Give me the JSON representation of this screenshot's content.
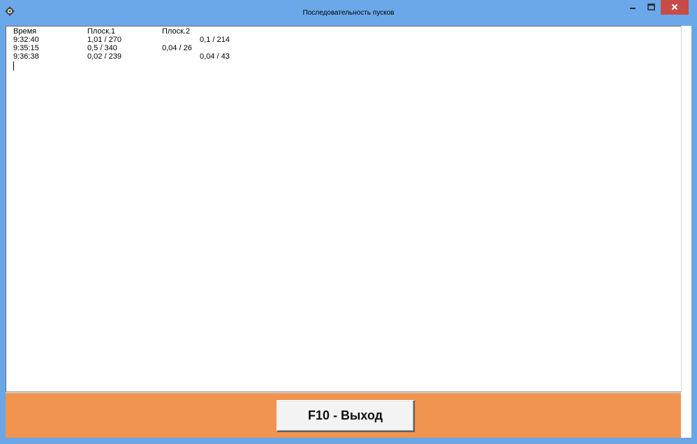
{
  "window": {
    "title": "Последовательность пусков",
    "icon": "gear-icon",
    "controls": [
      "minimize-icon",
      "maximize-icon",
      "close-icon"
    ]
  },
  "table": {
    "headers": [
      "Время",
      "Плоск.1",
      "Плоск.2"
    ],
    "rows": [
      {
        "time": "9:32:40",
        "p1": "1,01 / 270",
        "p2": "0,1 / 214"
      },
      {
        "time": "9:35:15",
        "p1": "0,5 / 340",
        "p2": "0,04 / 26"
      },
      {
        "time": "9:36:38",
        "p1": "0,02 / 239",
        "p2": "0,04 / 43"
      }
    ]
  },
  "footer": {
    "exit_label": "F10 - Выход"
  },
  "colors": {
    "titlebar": "#6ba8ea",
    "footer": "#f0944f",
    "close_button": "#c74b46"
  }
}
